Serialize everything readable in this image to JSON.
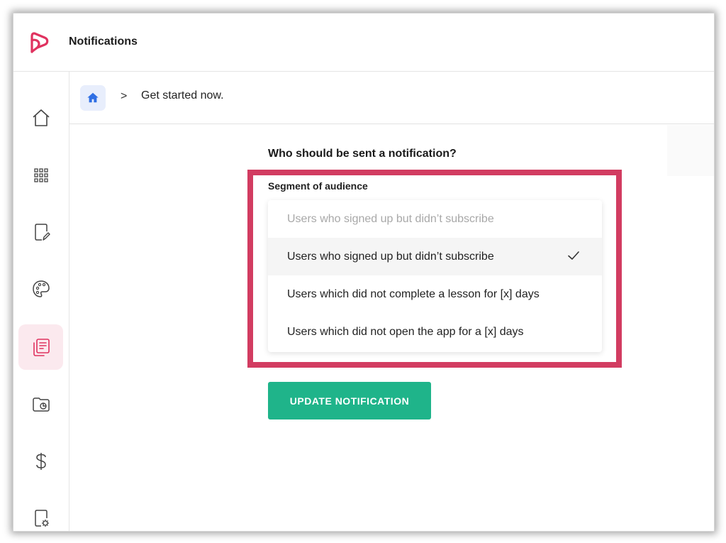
{
  "app": {
    "title": "Notifications",
    "brand_color": "#e0325f"
  },
  "sidebar": {
    "items": [
      {
        "icon": "home-icon",
        "active": false
      },
      {
        "icon": "apps-grid-icon",
        "active": false
      },
      {
        "icon": "edit-document-icon",
        "active": false
      },
      {
        "icon": "palette-icon",
        "active": false
      },
      {
        "icon": "notifications-list-icon",
        "active": true
      },
      {
        "icon": "folder-chart-icon",
        "active": false
      },
      {
        "icon": "dollar-icon",
        "active": false
      },
      {
        "icon": "document-settings-icon",
        "active": false
      }
    ]
  },
  "breadcrumb": {
    "home_icon": "home-icon",
    "separator": ">",
    "current": "Get started now."
  },
  "form": {
    "question": "Who should be sent a notification?",
    "segment_label": "Segment of audience",
    "dropdown": {
      "placeholder": "Users who signed up but didn’t subscribe",
      "options": [
        {
          "label": "Users who signed up but didn’t subscribe",
          "selected": true
        },
        {
          "label": "Users which did not complete a lesson for [x] days",
          "selected": false
        },
        {
          "label": "Users which did not open the app for a [x] days",
          "selected": false
        }
      ]
    },
    "submit_label": "UPDATE NOTIFICATION"
  },
  "colors": {
    "highlight": "#d23c61",
    "primary_button": "#1fb48a",
    "active_nav_bg": "#fbe9ee",
    "home_button_bg": "#e8eefc"
  }
}
